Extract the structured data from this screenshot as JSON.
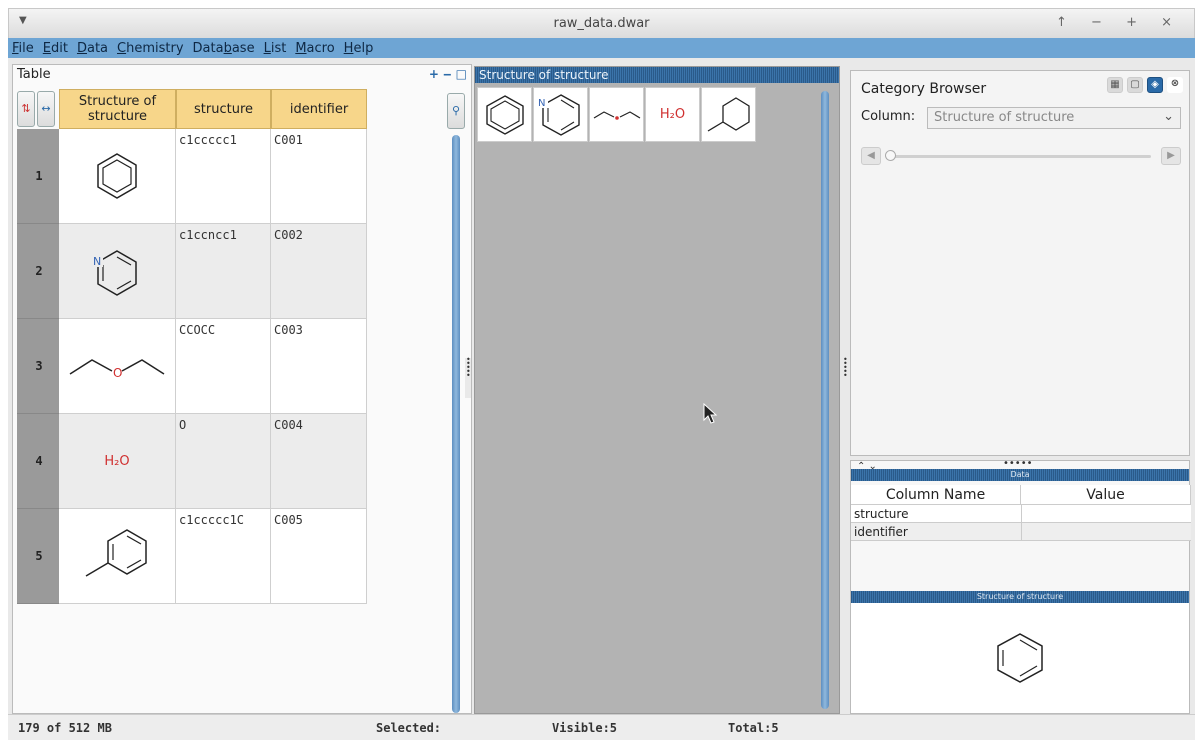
{
  "window": {
    "title": "raw_data.dwar"
  },
  "menu": {
    "items": [
      {
        "label": "File",
        "u": "F",
        "rest": "ile"
      },
      {
        "label": "Edit",
        "u": "E",
        "rest": "dit"
      },
      {
        "label": "Data",
        "u": "D",
        "rest": "ata"
      },
      {
        "label": "Chemistry",
        "u": "C",
        "rest": "hemistry"
      },
      {
        "label": "Database",
        "pre": "Data",
        "u": "b",
        "rest": "ase"
      },
      {
        "label": "List",
        "u": "L",
        "rest": "ist"
      },
      {
        "label": "Macro",
        "u": "M",
        "rest": "acro"
      },
      {
        "label": "Help",
        "u": "H",
        "rest": "elp"
      }
    ]
  },
  "table_panel": {
    "title": "Table",
    "controls": "+ ‒ □",
    "columns": [
      "Structure of structure",
      "structure",
      "identifier"
    ],
    "rows": [
      {
        "num": "1",
        "smiles": "c1ccccc1",
        "id": "C001",
        "molecule": "benzene-icon"
      },
      {
        "num": "2",
        "smiles": "c1ccncc1",
        "id": "C002",
        "molecule": "pyridine-icon"
      },
      {
        "num": "3",
        "smiles": "CCOCC",
        "id": "C003",
        "molecule": "diethyl-ether-icon"
      },
      {
        "num": "4",
        "smiles": "O",
        "id": "C004",
        "molecule": "water-icon"
      },
      {
        "num": "5",
        "smiles": "c1ccccc1C",
        "id": "C005",
        "molecule": "toluene-icon"
      }
    ]
  },
  "structure_panel": {
    "title": "Structure of structure"
  },
  "category_browser": {
    "title": "Category Browser",
    "column_label": "Column:",
    "column_value": "Structure of structure"
  },
  "data_panel": {
    "title": "Data",
    "headers": [
      "Column Name",
      "Value"
    ],
    "rows": [
      {
        "name": "structure",
        "value": ""
      },
      {
        "name": "identifier",
        "value": ""
      }
    ],
    "structure_title": "Structure of structure"
  },
  "status": {
    "memory": "179 of 512 MB",
    "selected": "Selected:",
    "visible": "Visible:5",
    "total": "Total:5"
  },
  "atoms": {
    "n": "N",
    "o": "O",
    "water": "H₂O"
  },
  "colors": {
    "menubar": "#6ea5d4",
    "header": "#f7d68a",
    "accent": "#2a6aa8"
  }
}
